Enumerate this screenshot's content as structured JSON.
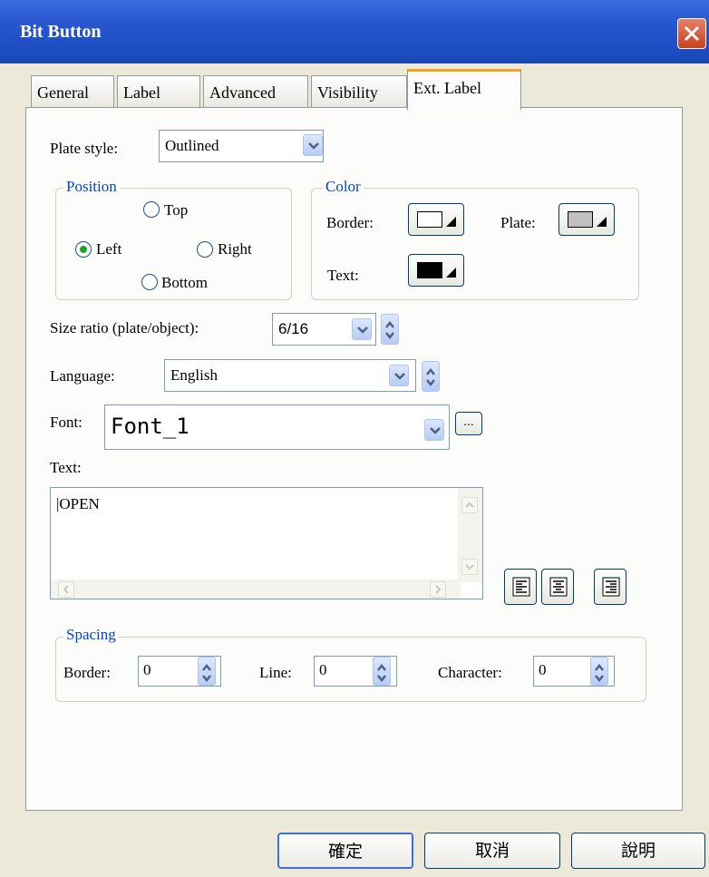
{
  "window": {
    "title": "Bit Button"
  },
  "tabs": [
    {
      "label": "General"
    },
    {
      "label": "Label"
    },
    {
      "label": "Advanced"
    },
    {
      "label": "Visibility"
    },
    {
      "label": "Ext. Label"
    }
  ],
  "plate_style": {
    "label": "Plate style:",
    "value": "Outlined"
  },
  "position": {
    "legend": "Position",
    "options": {
      "top": "Top",
      "left": "Left",
      "right": "Right",
      "bottom": "Bottom"
    },
    "selected": "Left"
  },
  "color": {
    "legend": "Color",
    "border_label": "Border:",
    "plate_label": "Plate:",
    "text_label": "Text:",
    "border_color": "#ffffff",
    "plate_color": "#c0c0c0",
    "text_color": "#000000"
  },
  "size_ratio": {
    "label": "Size ratio (plate/object):",
    "value": "6/16"
  },
  "language": {
    "label": "Language:",
    "value": "English"
  },
  "font": {
    "label": "Font:",
    "value": "Font_1",
    "browse_label": "..."
  },
  "text": {
    "label": "Text:",
    "value": "|OPEN"
  },
  "spacing": {
    "legend": "Spacing",
    "border_label": "Border:",
    "border_value": "0",
    "line_label": "Line:",
    "line_value": "0",
    "character_label": "Character:",
    "character_value": "0"
  },
  "buttons": {
    "ok": "確定",
    "cancel": "取消",
    "help": "說明"
  }
}
